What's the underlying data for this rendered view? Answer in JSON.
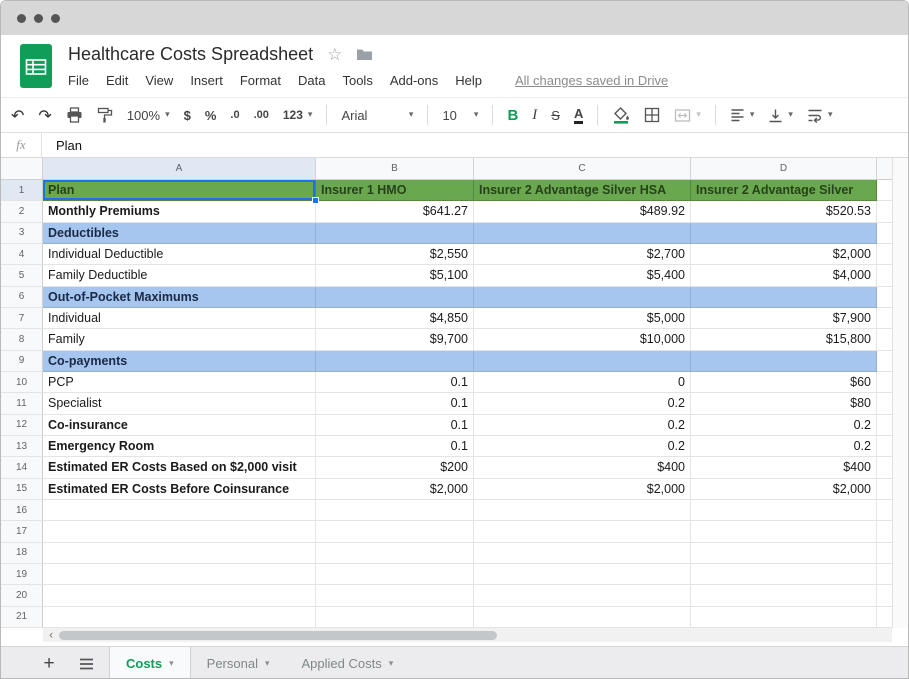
{
  "colors": {
    "accent": "#0f9d58",
    "header_bg": "#69a84f",
    "header_text": "#27421a",
    "section_bg": "#a6c5ef",
    "section_text": "#1b2a44",
    "selection": "#1a73e8"
  },
  "icons": {
    "undo": "↶",
    "redo": "↷",
    "caret": "▾",
    "star": "☆",
    "plus": "+",
    "scroll_left": "‹"
  },
  "header": {
    "title": "Healthcare Costs Spreadsheet",
    "saved_status": "All changes saved in Drive",
    "menu_items": [
      "File",
      "Edit",
      "View",
      "Insert",
      "Format",
      "Data",
      "Tools",
      "Add-ons",
      "Help"
    ]
  },
  "toolbar": {
    "zoom": "100%",
    "currency": "$",
    "percent": "%",
    "decimal_decrease": ".0",
    "decimal_increase": ".00",
    "number_format": "123",
    "font": "Arial",
    "font_size": "10",
    "bold": "B",
    "italic": "I",
    "strikethrough": "S",
    "text_color": "A"
  },
  "formula_bar": {
    "label": "fx",
    "value": "Plan"
  },
  "grid": {
    "column_headers": [
      "A",
      "B",
      "C",
      "D"
    ],
    "selected_cell": "A1",
    "rows": [
      {
        "n": 1,
        "style": "header",
        "bold": true,
        "cells": [
          "Plan",
          "Insurer 1 HMO",
          "Insurer 2 Advantage Silver HSA",
          "Insurer 2 Advantage Silver"
        ]
      },
      {
        "n": 2,
        "style": "data",
        "bold": true,
        "cells": [
          "Monthly Premiums",
          "$641.27",
          "$489.92",
          "$520.53"
        ]
      },
      {
        "n": 3,
        "style": "section",
        "bold": true,
        "cells": [
          "Deductibles",
          "",
          "",
          ""
        ]
      },
      {
        "n": 4,
        "style": "data",
        "bold": false,
        "cells": [
          "Individual Deductible",
          "$2,550",
          "$2,700",
          "$2,000"
        ]
      },
      {
        "n": 5,
        "style": "data",
        "bold": false,
        "cells": [
          "Family Deductible",
          "$5,100",
          "$5,400",
          "$4,000"
        ]
      },
      {
        "n": 6,
        "style": "section",
        "bold": true,
        "cells": [
          "Out-of-Pocket Maximums",
          "",
          "",
          ""
        ]
      },
      {
        "n": 7,
        "style": "data",
        "bold": false,
        "cells": [
          "Individual",
          "$4,850",
          "$5,000",
          "$7,900"
        ]
      },
      {
        "n": 8,
        "style": "data",
        "bold": false,
        "cells": [
          "Family",
          "$9,700",
          "$10,000",
          "$15,800"
        ]
      },
      {
        "n": 9,
        "style": "section",
        "bold": true,
        "cells": [
          "Co-payments",
          "",
          "",
          ""
        ]
      },
      {
        "n": 10,
        "style": "data",
        "bold": false,
        "cells": [
          "PCP",
          "0.1",
          "0",
          "$60"
        ]
      },
      {
        "n": 11,
        "style": "data",
        "bold": false,
        "cells": [
          "Specialist",
          "0.1",
          "0.2",
          "$80"
        ]
      },
      {
        "n": 12,
        "style": "data",
        "bold": true,
        "cells": [
          "Co-insurance",
          "0.1",
          "0.2",
          "0.2"
        ]
      },
      {
        "n": 13,
        "style": "data",
        "bold": true,
        "cells": [
          "Emergency Room",
          "0.1",
          "0.2",
          "0.2"
        ]
      },
      {
        "n": 14,
        "style": "data",
        "bold": true,
        "cells": [
          "Estimated ER Costs Based on $2,000 visit",
          "$200",
          "$400",
          "$400"
        ]
      },
      {
        "n": 15,
        "style": "data",
        "bold": true,
        "cells": [
          "Estimated ER Costs Before Coinsurance",
          "$2,000",
          "$2,000",
          "$2,000"
        ]
      },
      {
        "n": 16,
        "style": "empty",
        "bold": false,
        "cells": [
          "",
          "",
          "",
          ""
        ]
      },
      {
        "n": 17,
        "style": "empty",
        "bold": false,
        "cells": [
          "",
          "",
          "",
          ""
        ]
      },
      {
        "n": 18,
        "style": "empty",
        "bold": false,
        "cells": [
          "",
          "",
          "",
          ""
        ]
      },
      {
        "n": 19,
        "style": "empty",
        "bold": false,
        "cells": [
          "",
          "",
          "",
          ""
        ]
      },
      {
        "n": 20,
        "style": "empty",
        "bold": false,
        "cells": [
          "",
          "",
          "",
          ""
        ]
      },
      {
        "n": 21,
        "style": "empty",
        "bold": false,
        "cells": [
          "",
          "",
          "",
          ""
        ]
      }
    ]
  },
  "sheet_tabs": {
    "tabs": [
      {
        "label": "Costs",
        "active": true
      },
      {
        "label": "Personal",
        "active": false
      },
      {
        "label": "Applied Costs",
        "active": false
      }
    ]
  }
}
